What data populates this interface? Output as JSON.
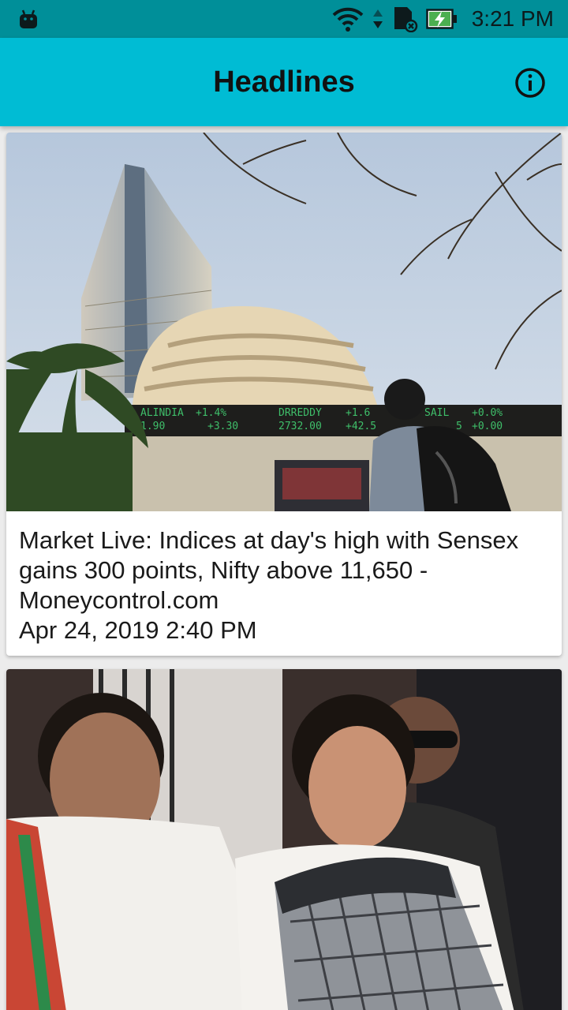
{
  "status_bar": {
    "time": "3:21 PM",
    "icons": [
      "android-icon",
      "wifi-icon",
      "data-arrows-icon",
      "sd-card-icon",
      "battery-charging-icon"
    ]
  },
  "app_bar": {
    "title": "Headlines",
    "info_icon": "info-icon"
  },
  "articles": [
    {
      "headline": "Market Live: Indices at day's high with Sensex gains 300 points, Nifty above 11,650 - Moneycontrol.com",
      "date": "Apr 24, 2019 2:40 PM",
      "image": "Bombay Stock Exchange building with ticker board",
      "ticker": [
        {
          "symbol": "ALINDIA",
          "change": "+1.4%",
          "price": "1.90",
          "delta": "+3.30"
        },
        {
          "symbol": "DRREDDY",
          "change": "+1.6",
          "price": "2732.00",
          "delta": "+42.5"
        },
        {
          "symbol": "SAIL",
          "change": "+0.0%",
          "price": "5",
          "delta": "+0.00"
        }
      ]
    },
    {
      "headline": "",
      "date": "",
      "image": "Two people walking, one in white kurta and one in checked saree"
    }
  ],
  "colors": {
    "status_bar": "#008f99",
    "app_bar": "#00bcd4",
    "background": "#ececec",
    "ticker_text": "#3fbf6a"
  }
}
